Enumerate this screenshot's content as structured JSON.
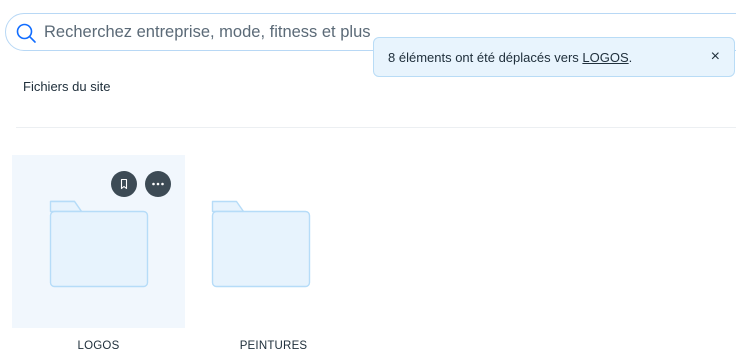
{
  "search": {
    "placeholder": "Recherchez entreprise, mode, fitness et plus",
    "value": ""
  },
  "toast": {
    "message_prefix": "8 éléments ont été déplacés vers ",
    "link_text": "LOGOS",
    "message_suffix": ".",
    "close_glyph": "×"
  },
  "section": {
    "title": "Fichiers du site"
  },
  "folders": [
    {
      "name": "LOGOS",
      "selected": true,
      "icon": "folder-icon",
      "actions": [
        "bookmark-icon",
        "more-icon"
      ]
    },
    {
      "name": "PEINTURES",
      "selected": false,
      "icon": "folder-icon"
    }
  ],
  "colors": {
    "accent": "#116dff",
    "folder_fill": "#e7f3fd",
    "folder_stroke": "#b6dcf8",
    "toast_bg": "#e8f4fd",
    "selected_tile_bg": "#f1f7fd",
    "action_button_bg": "#3d4b55"
  }
}
